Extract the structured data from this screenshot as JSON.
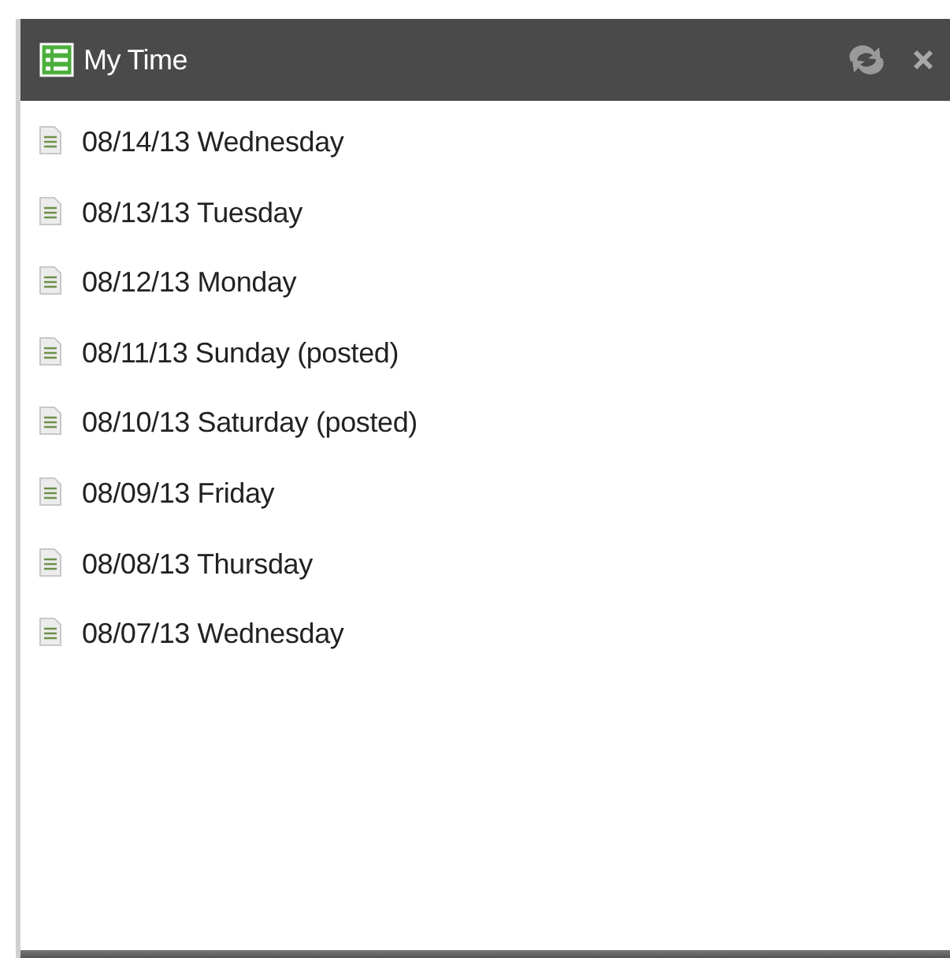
{
  "panel": {
    "title": "My Time"
  },
  "items": [
    {
      "label": "08/14/13 Wednesday"
    },
    {
      "label": "08/13/13 Tuesday"
    },
    {
      "label": "08/12/13 Monday"
    },
    {
      "label": "08/11/13 Sunday (posted)"
    },
    {
      "label": "08/10/13 Saturday (posted)"
    },
    {
      "label": "08/09/13 Friday"
    },
    {
      "label": "08/08/13 Thursday"
    },
    {
      "label": "08/07/13 Wednesday"
    }
  ]
}
